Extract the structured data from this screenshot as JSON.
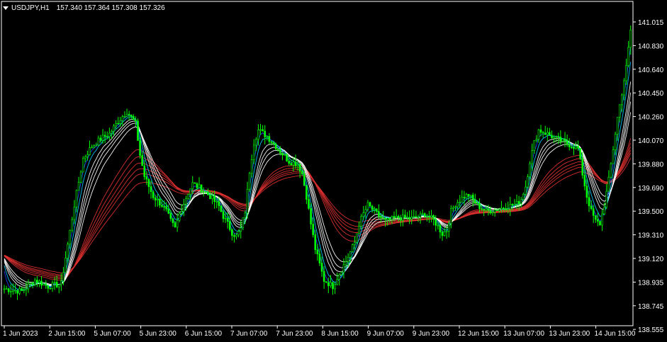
{
  "window": {
    "symbol_period": "USDJPY,H1",
    "quote": "157.340 157.364 157.308 157.326"
  },
  "colors": {
    "background": "#000000",
    "frame": "#ffffff",
    "candle": "#00ff00",
    "fast_ma_primary": "#1e3cff",
    "fast_ma_secondary": "#00c8ff",
    "fast_ma_ribbon": "#ffffff",
    "slow_ma_ribbon": "#e03030"
  },
  "chart_data": {
    "type": "candlestick",
    "y_ticks": [
      "141.015",
      "140.830",
      "140.640",
      "140.450",
      "140.260",
      "140.070",
      "139.880",
      "139.690",
      "139.500",
      "139.310",
      "139.120",
      "138.935",
      "138.745",
      "138.555"
    ],
    "x_ticks": [
      "1 Jun 2023",
      "2 Jun 15:00",
      "5 Jun 07:00",
      "5 Jun 23:00",
      "6 Jun 15:00",
      "7 Jun 07:00",
      "7 Jun 23:00",
      "8 Jun 15:00",
      "9 Jun 07:00",
      "9 Jun 23:00",
      "12 Jun 15:00",
      "13 Jun 07:00",
      "13 Jun 23:00",
      "14 Jun 15:00"
    ],
    "ylim": [
      138.555,
      141.015
    ],
    "price_path": [
      [
        0,
        138.88
      ],
      [
        8,
        138.86
      ],
      [
        14,
        138.95
      ],
      [
        20,
        138.9
      ],
      [
        26,
        138.92
      ],
      [
        32,
        139.55
      ],
      [
        36,
        139.92
      ],
      [
        40,
        140.02
      ],
      [
        44,
        140.08
      ],
      [
        48,
        140.12
      ],
      [
        52,
        140.22
      ],
      [
        56,
        140.3
      ],
      [
        60,
        140.2
      ],
      [
        62,
        139.95
      ],
      [
        64,
        139.78
      ],
      [
        68,
        139.62
      ],
      [
        72,
        139.55
      ],
      [
        74,
        139.5
      ],
      [
        76,
        139.42
      ],
      [
        78,
        139.36
      ],
      [
        80,
        139.48
      ],
      [
        84,
        139.65
      ],
      [
        86,
        139.72
      ],
      [
        90,
        139.68
      ],
      [
        94,
        139.62
      ],
      [
        98,
        139.54
      ],
      [
        100,
        139.46
      ],
      [
        102,
        139.4
      ],
      [
        104,
        139.33
      ],
      [
        106,
        139.3
      ],
      [
        108,
        139.36
      ],
      [
        110,
        139.5
      ],
      [
        112,
        139.82
      ],
      [
        114,
        140.05
      ],
      [
        116,
        140.15
      ],
      [
        120,
        140.1
      ],
      [
        124,
        140.02
      ],
      [
        128,
        139.94
      ],
      [
        130,
        139.9
      ],
      [
        134,
        139.88
      ],
      [
        136,
        139.8
      ],
      [
        138,
        139.62
      ],
      [
        140,
        139.4
      ],
      [
        142,
        139.2
      ],
      [
        146,
        138.95
      ],
      [
        150,
        138.9
      ],
      [
        152,
        138.97
      ],
      [
        156,
        139.1
      ],
      [
        160,
        139.25
      ],
      [
        162,
        139.4
      ],
      [
        164,
        139.48
      ],
      [
        166,
        139.55
      ],
      [
        170,
        139.48
      ],
      [
        174,
        139.42
      ],
      [
        180,
        139.45
      ],
      [
        186,
        139.44
      ],
      [
        190,
        139.46
      ],
      [
        192,
        139.48
      ],
      [
        196,
        139.43
      ],
      [
        198,
        139.38
      ],
      [
        200,
        139.32
      ],
      [
        202,
        139.35
      ],
      [
        204,
        139.5
      ],
      [
        206,
        139.56
      ],
      [
        210,
        139.62
      ],
      [
        212,
        139.63
      ],
      [
        216,
        139.55
      ],
      [
        220,
        139.5
      ],
      [
        226,
        139.52
      ],
      [
        230,
        139.54
      ],
      [
        232,
        139.55
      ],
      [
        234,
        139.56
      ],
      [
        236,
        139.6
      ],
      [
        238,
        139.7
      ],
      [
        240,
        139.9
      ],
      [
        242,
        140.05
      ],
      [
        244,
        140.15
      ],
      [
        248,
        140.12
      ],
      [
        252,
        140.08
      ],
      [
        256,
        140.05
      ],
      [
        260,
        140.02
      ],
      [
        262,
        140.0
      ],
      [
        264,
        139.8
      ],
      [
        266,
        139.62
      ],
      [
        268,
        139.5
      ],
      [
        270,
        139.42
      ],
      [
        272,
        139.4
      ],
      [
        274,
        139.55
      ],
      [
        276,
        139.75
      ],
      [
        278,
        140.0
      ],
      [
        280,
        140.25
      ],
      [
        282,
        140.45
      ],
      [
        284,
        140.65
      ],
      [
        286,
        140.95
      ]
    ],
    "series": [
      {
        "name": "",
        "color": "fast_ma_primary",
        "period": 3
      },
      {
        "name": "",
        "color": "fast_ma_secondary",
        "period": 5
      },
      {
        "name": "",
        "color": "fast_ma_ribbon",
        "period": 8
      },
      {
        "name": "",
        "color": "fast_ma_ribbon",
        "period": 10
      },
      {
        "name": "",
        "color": "fast_ma_ribbon",
        "period": 12
      },
      {
        "name": "",
        "color": "fast_ma_ribbon",
        "period": 15
      },
      {
        "name": "",
        "color": "slow_ma_ribbon",
        "period": 30
      },
      {
        "name": "",
        "color": "slow_ma_ribbon",
        "period": 35
      },
      {
        "name": "",
        "color": "slow_ma_ribbon",
        "period": 40
      },
      {
        "name": "",
        "color": "slow_ma_ribbon",
        "period": 45
      },
      {
        "name": "",
        "color": "slow_ma_ribbon",
        "period": 50
      },
      {
        "name": "",
        "color": "slow_ma_ribbon",
        "period": 60
      }
    ]
  }
}
